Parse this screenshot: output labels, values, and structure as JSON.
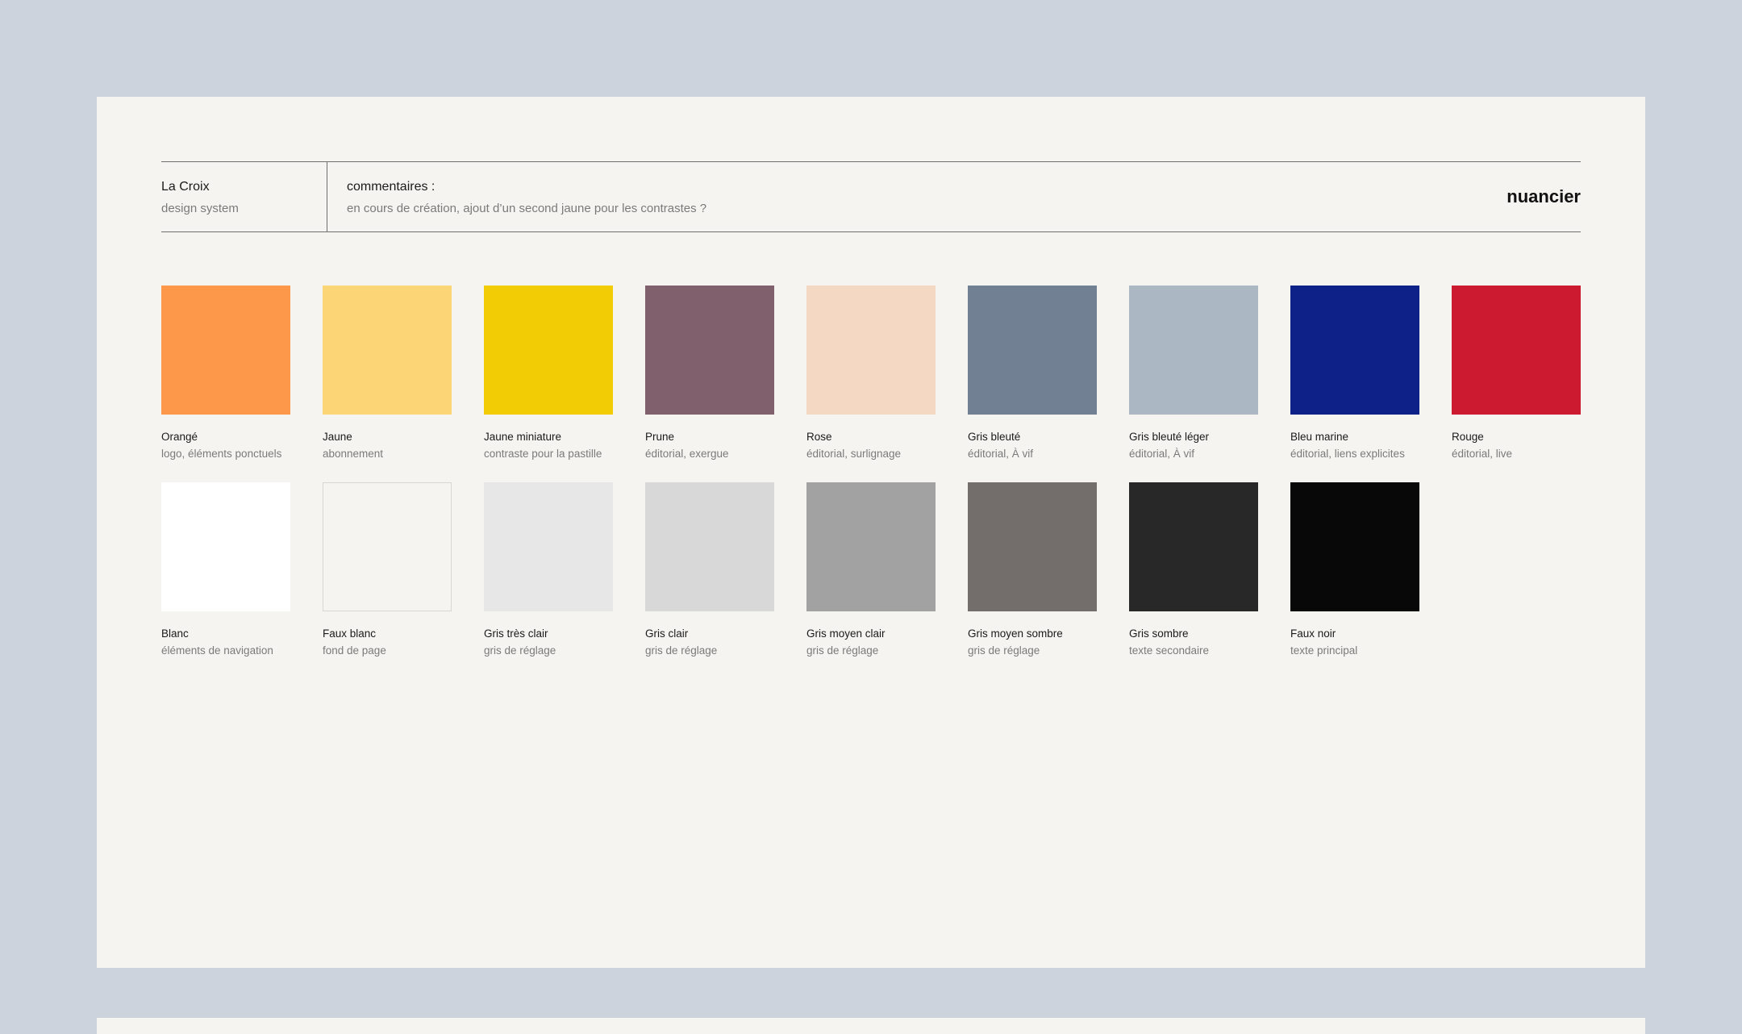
{
  "header": {
    "brand_name": "La Croix",
    "brand_subtitle": "design system",
    "comment_label": "commentaires :",
    "comment_text": "en cours de création, ajout d’un second jaune pour les contrastes ?",
    "page_title": "nuancier"
  },
  "palette": {
    "row1": [
      {
        "name": "Orangé",
        "usage": "logo, éléments ponctuels",
        "color": "#fd984a"
      },
      {
        "name": "Jaune",
        "usage": "abonnement",
        "color": "#fbd576"
      },
      {
        "name": "Jaune miniature",
        "usage": "contraste pour la pastille",
        "color": "#f2cd06"
      },
      {
        "name": "Prune",
        "usage": "éditorial, exergue",
        "color": "#81606e"
      },
      {
        "name": "Rose",
        "usage": "éditorial, surlignage",
        "color": "#f4d8c4"
      },
      {
        "name": "Gris bleuté",
        "usage": "éditorial, À vif",
        "color": "#718093"
      },
      {
        "name": "Gris bleuté léger",
        "usage": "éditorial, À vif",
        "color": "#abb7c3"
      },
      {
        "name": "Bleu marine",
        "usage": "éditorial, liens explicites",
        "color": "#0d2188"
      },
      {
        "name": "Rouge",
        "usage": "éditorial, live",
        "color": "#cc1a31"
      }
    ],
    "row2": [
      {
        "name": "Blanc",
        "usage": "éléments de navigation",
        "color": "#ffffff"
      },
      {
        "name": "Faux blanc",
        "usage": "fond de page",
        "color": "#f5f4f0"
      },
      {
        "name": "Gris très clair",
        "usage": "gris de réglage",
        "color": "#e7e7e7"
      },
      {
        "name": "Gris clair",
        "usage": "gris de réglage",
        "color": "#d8d8d8"
      },
      {
        "name": "Gris moyen clair",
        "usage": "gris de réglage",
        "color": "#a2a2a2"
      },
      {
        "name": "Gris moyen sombre",
        "usage": "gris de réglage",
        "color": "#736d6b"
      },
      {
        "name": "Gris sombre",
        "usage": "texte secondaire",
        "color": "#282828"
      },
      {
        "name": "Faux noir",
        "usage": "texte principal",
        "color": "#080808"
      }
    ]
  }
}
